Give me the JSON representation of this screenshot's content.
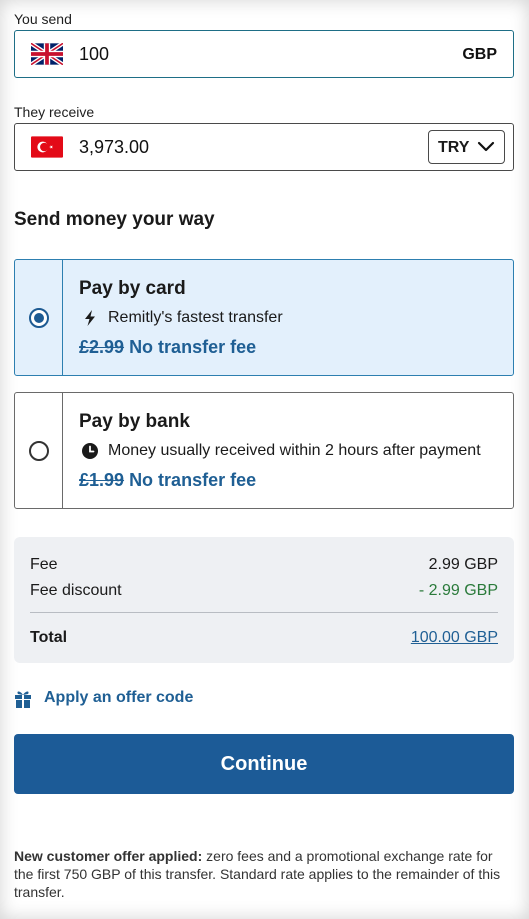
{
  "send": {
    "label": "You send",
    "amount": "100",
    "currency": "GBP",
    "flag_icon": "uk-flag-icon"
  },
  "receive": {
    "label": "They receive",
    "amount": "3,973.00",
    "currency": "TRY",
    "flag_icon": "turkey-flag-icon"
  },
  "section_title": "Send money your way",
  "options": [
    {
      "title": "Pay by card",
      "subtitle": "Remitly's fastest transfer",
      "icon": "lightning-icon",
      "old_fee": "£2.99",
      "fee_label": "No transfer fee",
      "selected": true
    },
    {
      "title": "Pay by bank",
      "subtitle": "Money usually received within 2 hours after payment",
      "icon": "clock-icon",
      "old_fee": "£1.99",
      "fee_label": "No transfer fee",
      "selected": false
    }
  ],
  "summary": {
    "fee_label": "Fee",
    "fee_value": "2.99 GBP",
    "discount_label": "Fee discount",
    "discount_value": "- 2.99 GBP",
    "total_label": "Total",
    "total_value": "100.00 GBP"
  },
  "offer_code_label": "Apply an offer code",
  "continue_label": "Continue",
  "note": {
    "bold": "New customer offer applied:",
    "text": " zero fees and a promotional exchange rate for the first 750 GBP of this transfer. Standard rate applies to the remainder of this transfer."
  },
  "colors": {
    "accent": "#1c5b97",
    "selected_bg": "#e3f0fc",
    "discount": "#2a7a3a"
  }
}
